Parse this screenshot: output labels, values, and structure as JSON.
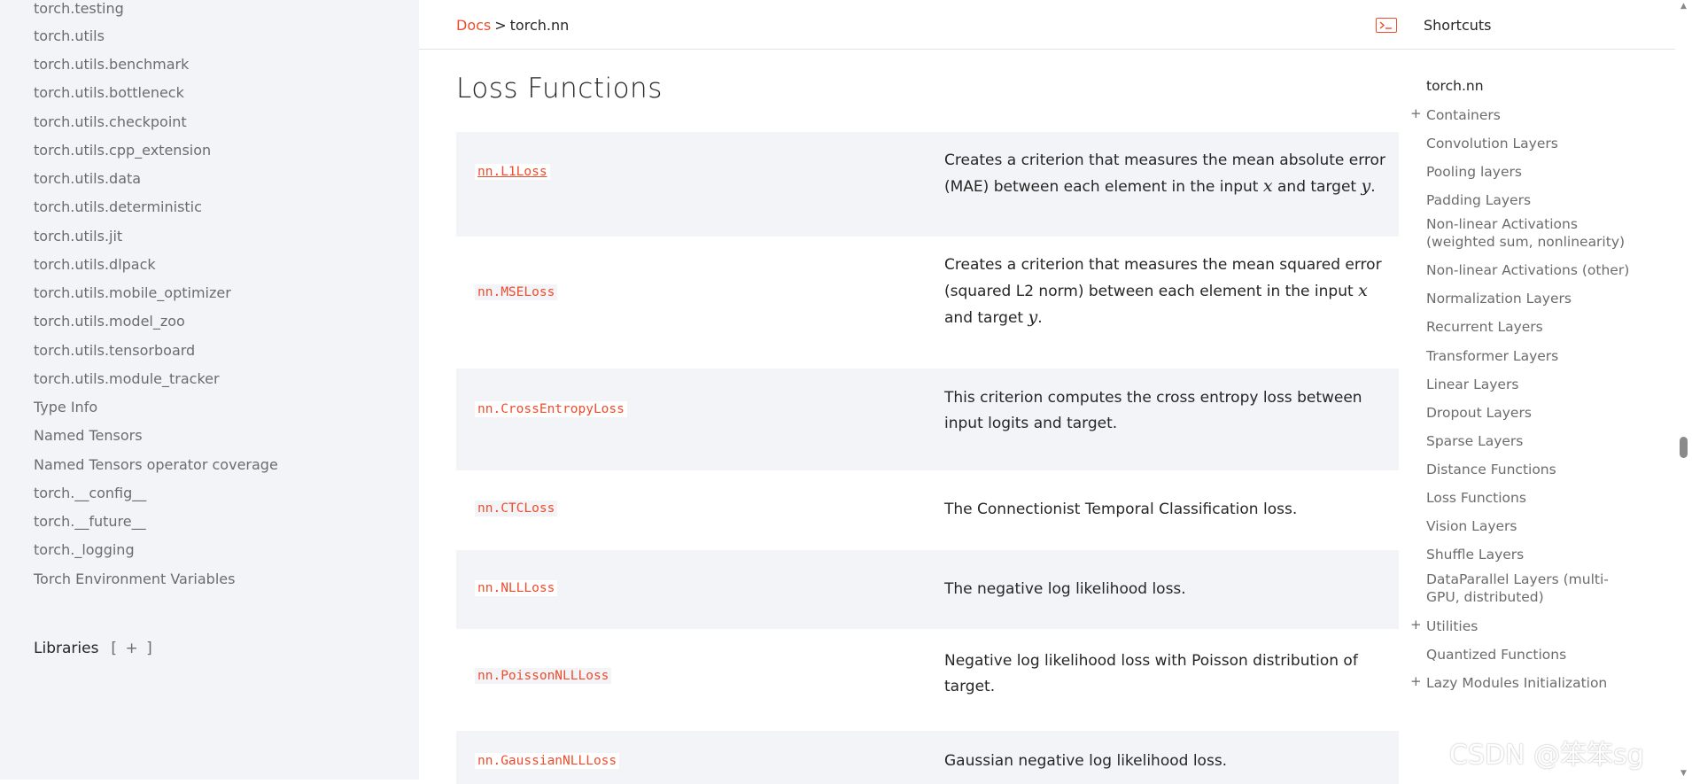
{
  "left_sidebar": {
    "items": [
      "torch.testing",
      "torch.utils",
      "torch.utils.benchmark",
      "torch.utils.bottleneck",
      "torch.utils.checkpoint",
      "torch.utils.cpp_extension",
      "torch.utils.data",
      "torch.utils.deterministic",
      "torch.utils.jit",
      "torch.utils.dlpack",
      "torch.utils.mobile_optimizer",
      "torch.utils.model_zoo",
      "torch.utils.tensorboard",
      "torch.utils.module_tracker",
      "Type Info",
      "Named Tensors",
      "Named Tensors operator coverage",
      "torch.__config__",
      "torch.__future__",
      "torch._logging",
      "Torch Environment Variables"
    ],
    "libraries_label": "Libraries",
    "libraries_toggle": "[ + ]"
  },
  "header": {
    "breadcrumb_docs": "Docs",
    "breadcrumb_sep": ">",
    "breadcrumb_current": "torch.nn",
    "shortcuts_label": "Shortcuts",
    "shortcuts_icon": "terminal-icon"
  },
  "main": {
    "title": "Loss Functions",
    "rows": [
      {
        "name": "nn.L1Loss",
        "desc_parts": [
          "Creates a criterion that measures the mean absolute error (MAE) between each element in the input ",
          "x",
          " and target ",
          "y",
          "."
        ]
      },
      {
        "name": "nn.MSELoss",
        "desc_parts": [
          "Creates a criterion that measures the mean squared error (squared L2 norm) between each element in the input ",
          "x",
          " and target ",
          "y",
          "."
        ]
      },
      {
        "name": "nn.CrossEntropyLoss",
        "desc": "This criterion computes the cross entropy loss between input logits and target."
      },
      {
        "name": "nn.CTCLoss",
        "desc": "The Connectionist Temporal Classification loss."
      },
      {
        "name": "nn.NLLLoss",
        "desc": "The negative log likelihood loss."
      },
      {
        "name": "nn.PoissonNLLLoss",
        "desc": "Negative log likelihood loss with Poisson distribution of target."
      },
      {
        "name": "nn.GaussianNLLLoss",
        "desc": "Gaussian negative log likelihood loss."
      }
    ]
  },
  "toc": {
    "items": [
      {
        "label": "torch.nn",
        "plus": ""
      },
      {
        "label": "Containers",
        "plus": "+"
      },
      {
        "label": "Convolution Layers",
        "plus": ""
      },
      {
        "label": "Pooling layers",
        "plus": ""
      },
      {
        "label": "Padding Layers",
        "plus": ""
      },
      {
        "label": "Non-linear Activations (weighted sum, nonlinearity)",
        "plus": ""
      },
      {
        "label": "Non-linear Activations (other)",
        "plus": ""
      },
      {
        "label": "Normalization Layers",
        "plus": ""
      },
      {
        "label": "Recurrent Layers",
        "plus": ""
      },
      {
        "label": "Transformer Layers",
        "plus": ""
      },
      {
        "label": "Linear Layers",
        "plus": ""
      },
      {
        "label": "Dropout Layers",
        "plus": ""
      },
      {
        "label": "Sparse Layers",
        "plus": ""
      },
      {
        "label": "Distance Functions",
        "plus": ""
      },
      {
        "label": "Loss Functions",
        "plus": ""
      },
      {
        "label": "Vision Layers",
        "plus": ""
      },
      {
        "label": "Shuffle Layers",
        "plus": ""
      },
      {
        "label": "DataParallel Layers (multi-GPU, distributed)",
        "plus": ""
      },
      {
        "label": "Utilities",
        "plus": "+"
      },
      {
        "label": "Quantized Functions",
        "plus": ""
      },
      {
        "label": "Lazy Modules Initialization",
        "plus": "+"
      }
    ]
  },
  "watermark": "CSDN @笨笨sg",
  "colors": {
    "accent": "#ee4c2c",
    "sidebar_bg": "#f3f4f7",
    "row_shade": "#f3f4f7",
    "text": "#262626",
    "muted_text": "#6c6c6d"
  }
}
